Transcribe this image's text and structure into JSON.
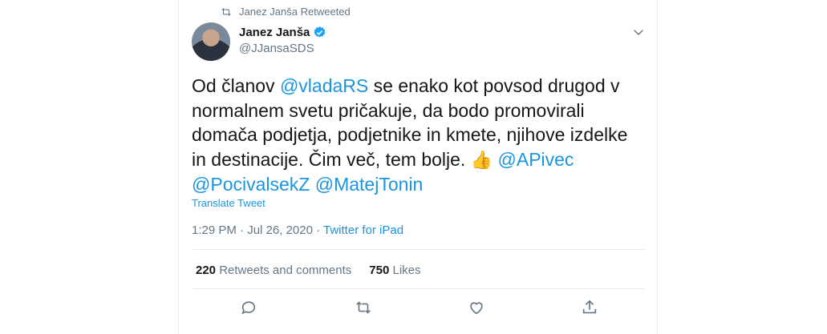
{
  "retweet_context": {
    "icon": "retweet-icon",
    "text": "Janez Janša Retweeted"
  },
  "author": {
    "name": "Janez Janša",
    "handle": "@JJansaSDS",
    "verified_icon": "verified-badge-icon"
  },
  "tweet": {
    "text_1": "Od članov ",
    "mention_1": "@vladaRS",
    "text_2": " se enako kot povsod drugod v normalnem svetu pričakuje, da bodo promovirali domača podjetja, podjetnike in kmete, njihove izdelke in destinacije. Čim več, tem bolje. ",
    "emoji": "👍",
    "mention_2": "@APivec",
    "mention_3": "@PocivalsekZ",
    "mention_4": "@MatejTonin"
  },
  "translate_label": "Translate Tweet",
  "meta": {
    "time": "1:29 PM",
    "separator": " · ",
    "date": "Jul 26, 2020",
    "source": "Twitter for iPad"
  },
  "stats": {
    "retweets_count": "220",
    "retweets_label": "Retweets and comments",
    "likes_count": "750",
    "likes_label": "Likes"
  },
  "actions": [
    "reply-icon",
    "retweet-icon",
    "like-icon",
    "share-icon"
  ],
  "colors": {
    "accent": "#1b95e0",
    "secondary": "#657786",
    "text": "#14171a",
    "border": "#e6ecf0"
  }
}
